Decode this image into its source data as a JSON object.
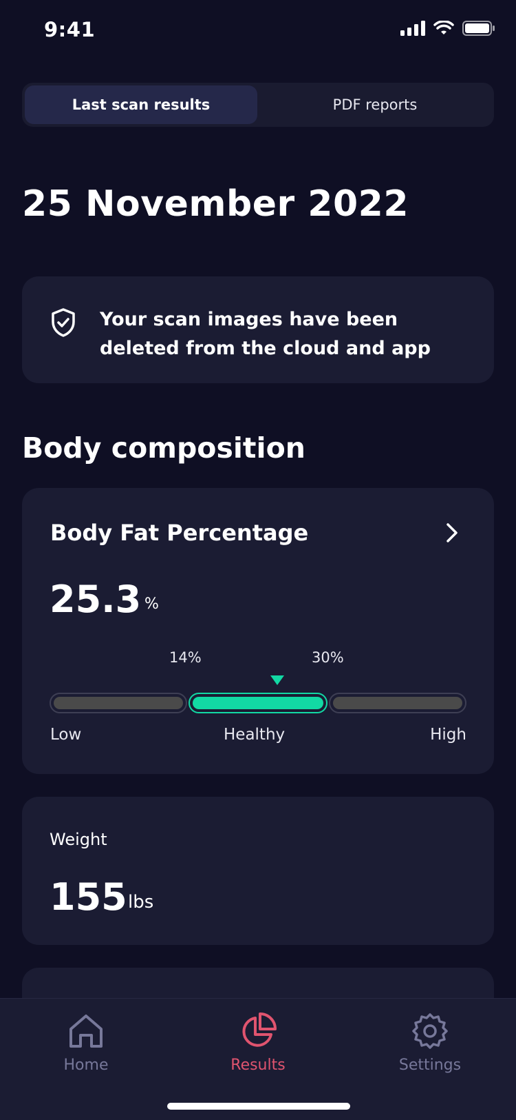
{
  "status_bar": {
    "time": "9:41"
  },
  "segmented": {
    "tabs": [
      "Last scan results",
      "PDF reports"
    ],
    "active": 0
  },
  "page_title": "25 November 2022",
  "notice": {
    "text": "Your scan images have been deleted from the cloud and app",
    "icon": "shield-check-icon"
  },
  "section_title": "Body composition",
  "body_fat": {
    "title": "Body Fat Percentage",
    "value": "25.3",
    "unit": "%",
    "thresholds": [
      "14%",
      "30%"
    ],
    "ranges": [
      "Low",
      "Healthy",
      "High"
    ],
    "active_range": "Healthy",
    "accent_color": "#12d9a4"
  },
  "weight": {
    "label": "Weight",
    "value": "155",
    "unit": "lbs"
  },
  "tab_bar": {
    "items": [
      {
        "label": "Home",
        "icon": "home-icon"
      },
      {
        "label": "Results",
        "icon": "pie-chart-icon"
      },
      {
        "label": "Settings",
        "icon": "gear-icon"
      }
    ],
    "active": 1,
    "active_color": "#e0546f",
    "inactive_color": "#77789a"
  }
}
